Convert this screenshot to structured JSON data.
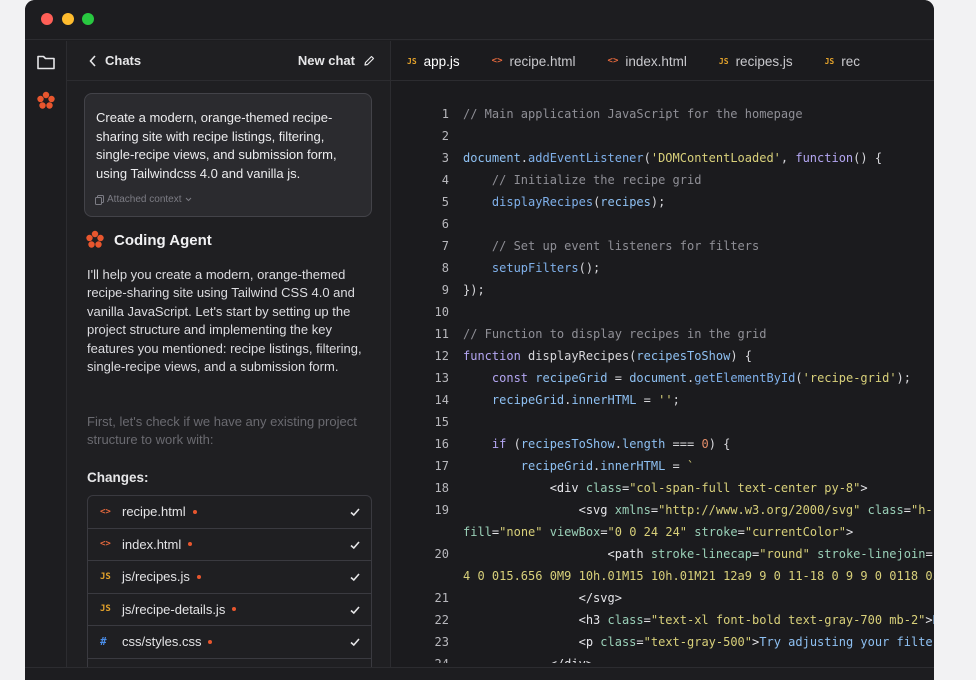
{
  "window": {
    "traffic_lights": [
      "close",
      "minimize",
      "maximize"
    ],
    "colors": {
      "red": "#ff5f57",
      "yellow": "#febc2e",
      "green": "#28c840",
      "accent": "#e8562e"
    }
  },
  "rail": {
    "items": [
      {
        "icon": "folder-icon"
      },
      {
        "icon": "agent-logo-icon"
      }
    ]
  },
  "chat": {
    "back_label": "Chats",
    "new_chat_label": "New chat",
    "prompt": "Create a modern, orange-themed recipe-sharing site with recipe listings, filtering, single-recipe views, and submission form, using Tailwindcss 4.0 and vanilla js.",
    "attached_context_label": "Attached context",
    "agent_name": "Coding Agent",
    "agent_message": "I'll help you create a modern, orange-themed recipe-sharing site using Tailwind CSS 4.0 and vanilla JavaScript. Let's start by setting up the project structure and implementing the key features you mentioned: recipe listings, filtering, single-recipe views, and a submission form.",
    "agent_message_faded": "First, let's check if we have any existing project structure to work with:",
    "changes_label": "Changes:",
    "changes": [
      {
        "icon": "<>",
        "type": "html",
        "name": "recipe.html"
      },
      {
        "icon": "<>",
        "type": "html",
        "name": "index.html"
      },
      {
        "icon": "JS",
        "type": "js",
        "name": "js/recipes.js"
      },
      {
        "icon": "JS",
        "type": "js",
        "name": "js/recipe-details.js"
      },
      {
        "icon": "#",
        "type": "css",
        "name": "css/styles.css"
      }
    ]
  },
  "editor": {
    "tabs": [
      {
        "icon": "JS",
        "type": "js",
        "label": "app.js",
        "active": true
      },
      {
        "icon": "<>",
        "type": "html",
        "label": "recipe.html"
      },
      {
        "icon": "<>",
        "type": "html",
        "label": "index.html"
      },
      {
        "icon": "JS",
        "type": "js",
        "label": "recipes.js"
      },
      {
        "icon": "JS",
        "type": "js",
        "label": "rec"
      }
    ],
    "lines": [
      {
        "n": "1",
        "tokens": [
          [
            "c",
            "// Main application JavaScript for the homepage"
          ]
        ]
      },
      {
        "n": "2",
        "tokens": []
      },
      {
        "n": "3",
        "tokens": [
          [
            "v",
            "document"
          ],
          [
            "p",
            "."
          ],
          [
            "f",
            "addEventListener"
          ],
          [
            "p",
            "("
          ],
          [
            "s",
            "'DOMContentLoaded'"
          ],
          [
            "p",
            ", "
          ],
          [
            "k",
            "function"
          ],
          [
            "p",
            "() {"
          ]
        ]
      },
      {
        "n": "4",
        "tokens": [
          [
            "p",
            "    "
          ],
          [
            "c",
            "// Initialize the recipe grid"
          ]
        ]
      },
      {
        "n": "5",
        "tokens": [
          [
            "p",
            "    "
          ],
          [
            "f",
            "displayRecipes"
          ],
          [
            "p",
            "("
          ],
          [
            "v",
            "recipes"
          ],
          [
            "p",
            ");"
          ]
        ]
      },
      {
        "n": "6",
        "tokens": []
      },
      {
        "n": "7",
        "tokens": [
          [
            "p",
            "    "
          ],
          [
            "c",
            "// Set up event listeners for filters"
          ]
        ]
      },
      {
        "n": "8",
        "tokens": [
          [
            "p",
            "    "
          ],
          [
            "f",
            "setupFilters"
          ],
          [
            "p",
            "();"
          ]
        ]
      },
      {
        "n": "9",
        "tokens": [
          [
            "p",
            "});"
          ]
        ]
      },
      {
        "n": "10",
        "tokens": []
      },
      {
        "n": "11",
        "tokens": [
          [
            "c",
            "// Function to display recipes in the grid"
          ]
        ]
      },
      {
        "n": "12",
        "tokens": [
          [
            "k",
            "function"
          ],
          [
            "p",
            " displayRecipes("
          ],
          [
            "v",
            "recipesToShow"
          ],
          [
            "p",
            ") {"
          ]
        ]
      },
      {
        "n": "13",
        "tokens": [
          [
            "p",
            "    "
          ],
          [
            "k",
            "const"
          ],
          [
            "p",
            " "
          ],
          [
            "v",
            "recipeGrid"
          ],
          [
            "p",
            " = "
          ],
          [
            "v",
            "document"
          ],
          [
            "p",
            "."
          ],
          [
            "f",
            "getElementById"
          ],
          [
            "p",
            "("
          ],
          [
            "s",
            "'recipe-grid'"
          ],
          [
            "p",
            ");"
          ]
        ]
      },
      {
        "n": "14",
        "tokens": [
          [
            "p",
            "    "
          ],
          [
            "v",
            "recipeGrid"
          ],
          [
            "p",
            "."
          ],
          [
            "v",
            "innerHTML"
          ],
          [
            "p",
            " = "
          ],
          [
            "s",
            "''"
          ],
          [
            "p",
            ";"
          ]
        ]
      },
      {
        "n": "15",
        "tokens": []
      },
      {
        "n": "16",
        "tokens": [
          [
            "p",
            "    "
          ],
          [
            "k",
            "if"
          ],
          [
            "p",
            " ("
          ],
          [
            "v",
            "recipesToShow"
          ],
          [
            "p",
            "."
          ],
          [
            "v",
            "length"
          ],
          [
            "p",
            " === "
          ],
          [
            "n",
            "0"
          ],
          [
            "p",
            ") {"
          ]
        ]
      },
      {
        "n": "17",
        "tokens": [
          [
            "p",
            "        "
          ],
          [
            "v",
            "recipeGrid"
          ],
          [
            "p",
            "."
          ],
          [
            "v",
            "innerHTML"
          ],
          [
            "p",
            " = "
          ],
          [
            "s",
            "`"
          ]
        ]
      },
      {
        "n": "18",
        "tokens": [
          [
            "p",
            "            "
          ],
          [
            "t",
            "<div "
          ],
          [
            "a",
            "class"
          ],
          [
            "t",
            "="
          ],
          [
            "s",
            "\"col-span-full text-center py-8\""
          ],
          [
            "t",
            ">"
          ]
        ]
      },
      {
        "n": "19",
        "tokens": [
          [
            "p",
            "                "
          ],
          [
            "t",
            "<svg "
          ],
          [
            "a",
            "xmlns"
          ],
          [
            "t",
            "="
          ],
          [
            "s",
            "\"http://www.w3.org/2000/svg\""
          ],
          [
            "t",
            " "
          ],
          [
            "a",
            "class"
          ],
          [
            "t",
            "="
          ],
          [
            "s",
            "\"h-16"
          ]
        ]
      },
      {
        "n": "",
        "tokens": [
          [
            "a",
            "fill"
          ],
          [
            "t",
            "="
          ],
          [
            "s",
            "\"none\""
          ],
          [
            "t",
            " "
          ],
          [
            "a",
            "viewBox"
          ],
          [
            "t",
            "="
          ],
          [
            "s",
            "\"0 0 24 24\""
          ],
          [
            "t",
            " "
          ],
          [
            "a",
            "stroke"
          ],
          [
            "t",
            "="
          ],
          [
            "s",
            "\"currentColor\""
          ],
          [
            "t",
            ">"
          ]
        ]
      },
      {
        "n": "20",
        "tokens": [
          [
            "p",
            "                    "
          ],
          [
            "t",
            "<path "
          ],
          [
            "a",
            "stroke-linecap"
          ],
          [
            "t",
            "="
          ],
          [
            "s",
            "\"round\""
          ],
          [
            "t",
            " "
          ],
          [
            "a",
            "stroke-linejoin"
          ],
          [
            "t",
            "="
          ],
          [
            "s",
            "\"ro"
          ]
        ]
      },
      {
        "n": "",
        "tokens": [
          [
            "s",
            "4 0 015.656 0M9 10h.01M15 10h.01M21 12a9 9 0 11-18 0 9 9 0 0118 0z\""
          ]
        ]
      },
      {
        "n": "21",
        "tokens": [
          [
            "p",
            "                "
          ],
          [
            "t",
            "</svg>"
          ]
        ]
      },
      {
        "n": "22",
        "tokens": [
          [
            "p",
            "                "
          ],
          [
            "t",
            "<h3 "
          ],
          [
            "a",
            "class"
          ],
          [
            "t",
            "="
          ],
          [
            "s",
            "\"text-xl font-bold text-gray-700 mb-2\""
          ],
          [
            "t",
            ">"
          ],
          [
            "v",
            "No"
          ]
        ]
      },
      {
        "n": "23",
        "tokens": [
          [
            "p",
            "                "
          ],
          [
            "t",
            "<p "
          ],
          [
            "a",
            "class"
          ],
          [
            "t",
            "="
          ],
          [
            "s",
            "\"text-gray-500\""
          ],
          [
            "t",
            ">"
          ],
          [
            "v",
            "Try adjusting your filters"
          ]
        ]
      },
      {
        "n": "24",
        "tokens": [
          [
            "p",
            "            "
          ],
          [
            "t",
            "</div>"
          ]
        ]
      }
    ]
  }
}
